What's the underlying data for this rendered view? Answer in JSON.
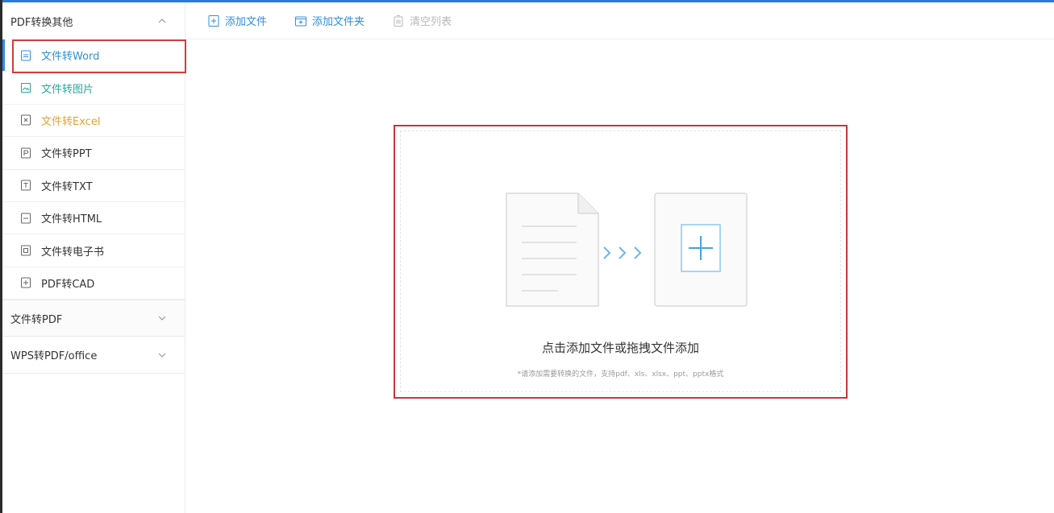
{
  "sidebar": {
    "groups": [
      {
        "label": "PDF转换其他",
        "expanded": true,
        "items": [
          {
            "label": "文件转Word",
            "icon": "word-file-icon"
          },
          {
            "label": "文件转图片",
            "icon": "image-file-icon"
          },
          {
            "label": "文件转Excel",
            "icon": "excel-file-icon"
          },
          {
            "label": "文件转PPT",
            "icon": "ppt-file-icon"
          },
          {
            "label": "文件转TXT",
            "icon": "txt-file-icon"
          },
          {
            "label": "文件转HTML",
            "icon": "html-file-icon"
          },
          {
            "label": "文件转电子书",
            "icon": "ebook-file-icon"
          },
          {
            "label": "PDF转CAD",
            "icon": "cad-file-icon"
          }
        ]
      },
      {
        "label": "文件转PDF",
        "expanded": false
      },
      {
        "label": "WPS转PDF/office",
        "expanded": false
      }
    ],
    "active_item": "文件转Word"
  },
  "toolbar": {
    "add_file": "添加文件",
    "add_folder": "添加文件夹",
    "clear_list": "清空列表"
  },
  "drop_zone": {
    "title": "点击添加文件或拖拽文件添加",
    "hint": "*请添加需要转换的文件，支持pdf、xls、xlsx、ppt、pptx格式"
  },
  "colors": {
    "accent": "#2f8fd8",
    "highlight_outline": "#d23c3c",
    "teal": "#2aa7a0",
    "orange": "#e0a23a"
  }
}
